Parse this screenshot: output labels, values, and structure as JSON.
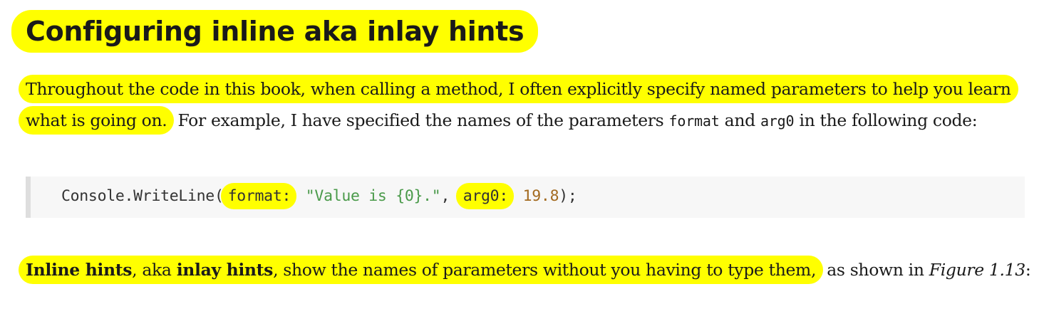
{
  "heading": "Configuring inline aka inlay hints",
  "paragraph1": {
    "highlight": "Throughout the code in this book, when calling a method, I often explicitly specify named parameters to help you learn what is going on.",
    "text_a": " For example, I have specified the names of the parameters ",
    "code_format": "format",
    "text_b": " and ",
    "code_arg0": "arg0",
    "text_c": " in the following code:"
  },
  "code": {
    "method": "Console.WriteLine(",
    "param1": "format:",
    "string_value": "\"Value is {0}.\"",
    "separator": ", ",
    "param2": "arg0:",
    "number_value": "19.8",
    "end": ");"
  },
  "paragraph2": {
    "bold1": "Inline hints",
    "text_a": ", aka ",
    "bold2": "inlay hints",
    "text_b": ", show the names of parameters without you having to type them,",
    "text_c": " as shown in ",
    "figure_ref": "Figure 1.13",
    "text_d": ":"
  },
  "colors": {
    "highlight": "#ffff00",
    "code_background": "#f7f7f7",
    "code_border": "#dedede",
    "string": "#4a9a4a",
    "number": "#a36a1f"
  }
}
